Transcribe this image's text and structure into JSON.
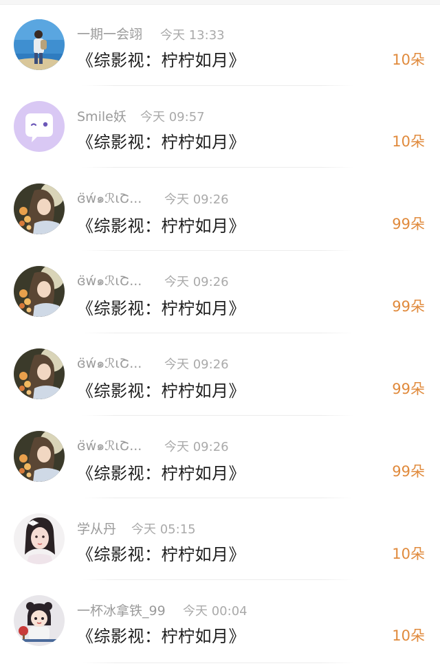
{
  "gifts": [
    {
      "name": "一期一会翊",
      "time": "今天 13:33",
      "title": "《综影视：柠柠如月》",
      "amount": "10朵",
      "avatar": "beach-person-icon"
    },
    {
      "name": "Smile妖",
      "time": "今天 09:57",
      "title": "《综影视：柠柠如月》",
      "amount": "10朵",
      "avatar": "chat-bubble-icon"
    },
    {
      "name": "ɞ̈ẃ๑ℛɩՇ...",
      "time": "今天 09:26",
      "title": "《综影视：柠柠如月》",
      "amount": "99朵",
      "avatar": "girl-flowers-portrait"
    },
    {
      "name": "ɞ̈ẃ๑ℛɩՇ...",
      "time": "今天 09:26",
      "title": "《综影视：柠柠如月》",
      "amount": "99朵",
      "avatar": "girl-flowers-portrait"
    },
    {
      "name": "ɞ̈ẃ๑ℛɩՇ...",
      "time": "今天 09:26",
      "title": "《综影视：柠柠如月》",
      "amount": "99朵",
      "avatar": "girl-flowers-portrait"
    },
    {
      "name": "ɞ̈ẃ๑ℛɩՇ...",
      "time": "今天 09:26",
      "title": "《综影视：柠柠如月》",
      "amount": "99朵",
      "avatar": "girl-flowers-portrait"
    },
    {
      "name": "学从丹",
      "time": "今天 05:15",
      "title": "《综影视：柠柠如月》",
      "amount": "10朵",
      "avatar": "girl-bow-portrait"
    },
    {
      "name": "一杯冰拿铁_99",
      "time": "今天 00:04",
      "title": "《综影视：柠柠如月》",
      "amount": "10朵",
      "avatar": "cartoon-girl-pingpong"
    }
  ],
  "colors": {
    "amount": "#e08a3c",
    "name": "#9a9a9a",
    "title": "#1e1e1e"
  }
}
